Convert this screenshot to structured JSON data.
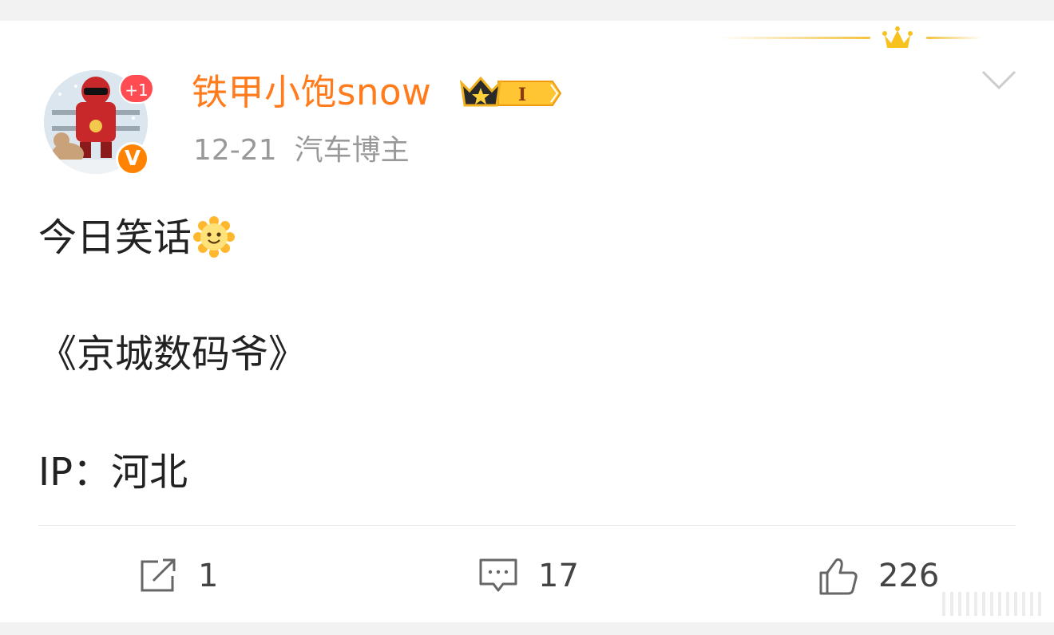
{
  "post": {
    "author": {
      "name": "铁甲小饱snow",
      "notification_badge": "+1",
      "verified_mark": "V",
      "vip_level": "I"
    },
    "meta": {
      "date": "12-21",
      "role": "汽车博主"
    },
    "content": {
      "line1": "今日笑话",
      "line2": "《京城数码爷》",
      "line3": "IP：河北"
    },
    "actions": {
      "share_count": "1",
      "comment_count": "17",
      "like_count": "226"
    }
  },
  "colors": {
    "username": "#ff7b1c",
    "verified": "#ff8200",
    "badge_red": "#ff4c52",
    "meta_text": "#999999"
  },
  "icons": [
    "crown-decoration-icon",
    "verified-v-icon",
    "vip-crown-badge-icon",
    "chevron-down-icon",
    "smile-emoji-icon",
    "share-icon",
    "comment-icon",
    "like-icon"
  ]
}
